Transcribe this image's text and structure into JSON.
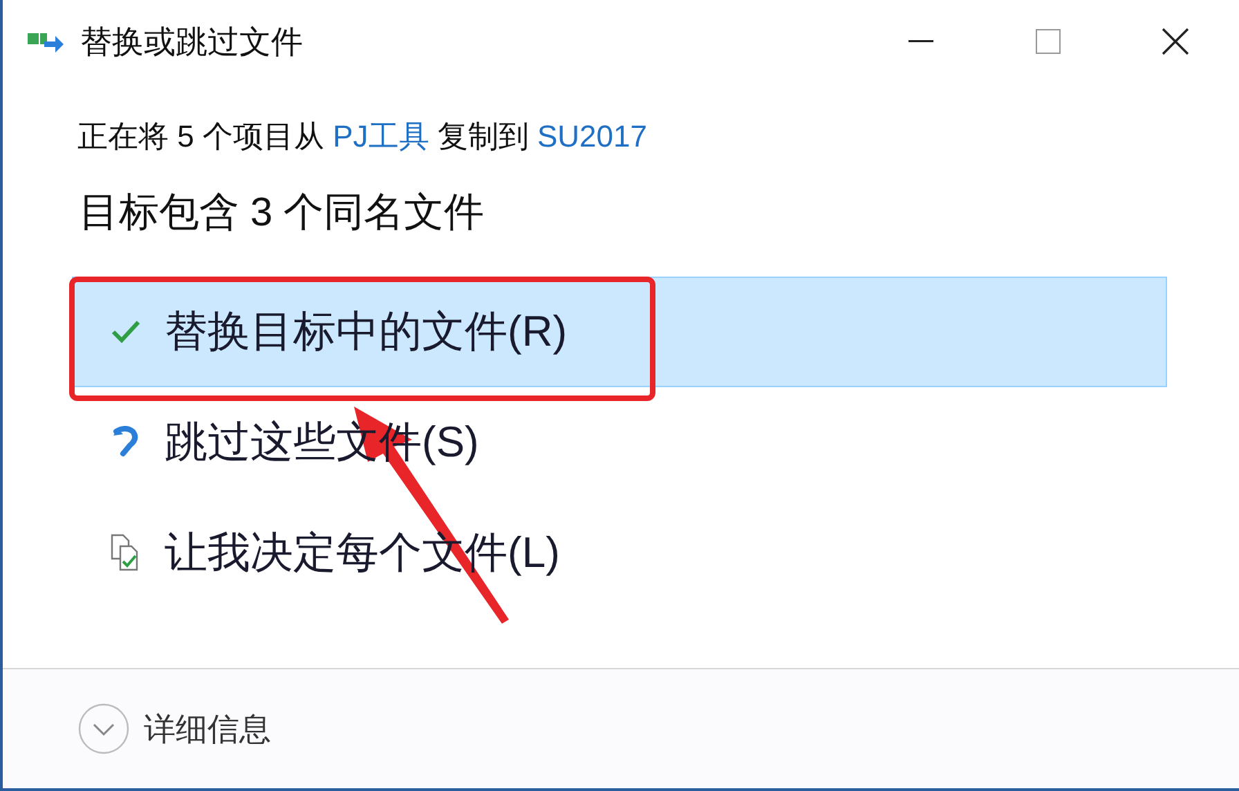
{
  "window": {
    "title": "替换或跳过文件"
  },
  "status": {
    "parts": [
      {
        "kind": "text",
        "text": "正在将 5 个项目从 "
      },
      {
        "kind": "link",
        "text": "PJ工具"
      },
      {
        "kind": "text",
        "text": " 复制到 "
      },
      {
        "kind": "link",
        "text": "SU2017"
      }
    ]
  },
  "heading": "目标包含 3 个同名文件",
  "options": [
    {
      "kind": "replace",
      "label": "替换目标中的文件(R)",
      "selected": true
    },
    {
      "kind": "skip",
      "label": "跳过这些文件(S)",
      "selected": false
    },
    {
      "kind": "decide",
      "label": "让我决定每个文件(L)",
      "selected": false
    }
  ],
  "details": {
    "label": "详细信息",
    "expanded": false
  },
  "highlight_box": {
    "color": "#e8262a"
  },
  "arrow": {
    "color": "#e8262a"
  }
}
